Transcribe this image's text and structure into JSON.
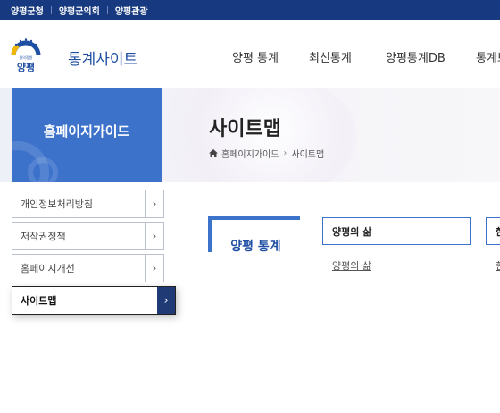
{
  "topbar": {
    "links": [
      "양평군청",
      "양평군의회",
      "양평관광"
    ]
  },
  "header": {
    "logo_text": "양평",
    "logo_small_text": "물의정원",
    "site_title": "통계사이트",
    "nav": [
      "양평 통계",
      "최신통계",
      "양평통계DB",
      "통계브"
    ]
  },
  "banner": {
    "side_title": "홈페이지가이드",
    "page_title": "사이트맵",
    "breadcrumb": [
      "홈페이지가이드",
      "사이트맵"
    ]
  },
  "side_menu": {
    "items": [
      {
        "label": "개인정보처리방침"
      },
      {
        "label": "저작권정책"
      },
      {
        "label": "홈페이지개선"
      },
      {
        "label": "사이트맵",
        "active": true
      }
    ],
    "arrow": "›"
  },
  "sitemap": {
    "section_title": "양평 통계",
    "categories": [
      {
        "title": "양평의 삶",
        "links": [
          "양평의 삶"
        ]
      },
      {
        "title": "한",
        "links": [
          "한"
        ]
      }
    ]
  },
  "colors": {
    "topbar": "#16397f",
    "accent": "#3d72cb",
    "active_arrow": "#1f3a75"
  }
}
